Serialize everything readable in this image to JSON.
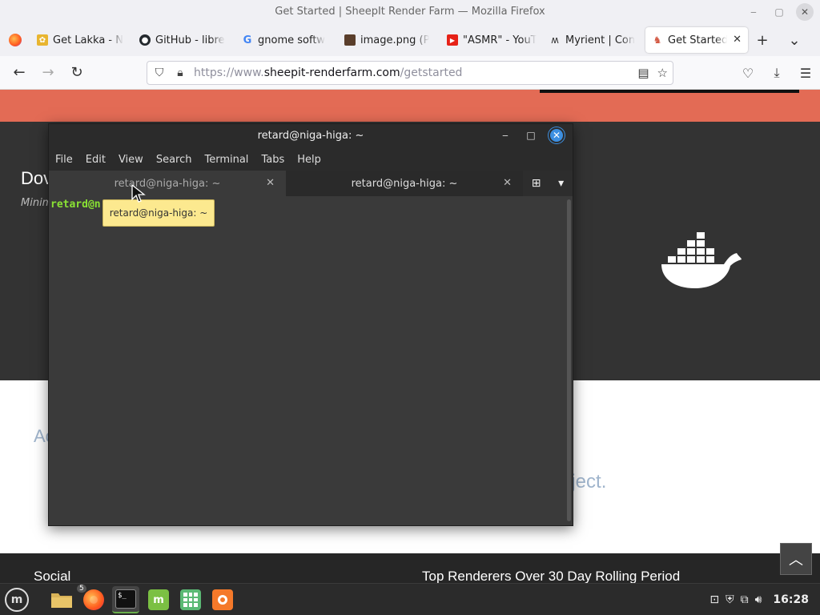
{
  "firefox": {
    "window_title": "Get Started | SheepIt Render Farm — Mozilla Firefox",
    "window_controls": {
      "minimize": "‒",
      "maximize": "▢",
      "close": "✕"
    },
    "tabs": [
      {
        "label": "Get Lakka - N",
        "icon": "lakka-favicon"
      },
      {
        "label": "GitHub - libre",
        "icon": "github-favicon"
      },
      {
        "label": "gnome softw",
        "icon": "google-favicon"
      },
      {
        "label": "image.png (P",
        "icon": "image-favicon"
      },
      {
        "label": "\"ASMR\" - YouT",
        "icon": "youtube-favicon"
      },
      {
        "label": "Myrient | Con",
        "icon": "myrient-favicon"
      },
      {
        "label": "Get Started",
        "icon": "sheepit-favicon",
        "active": true
      }
    ],
    "new_tab": "+",
    "tab_list": "⌄",
    "url": {
      "prefix": "https://www.",
      "host": "sheepit-renderfarm.com",
      "path": "/getstarted"
    },
    "back": "←",
    "forward": "→",
    "reload": "↻"
  },
  "page": {
    "download_title": "Dov",
    "download_sub": "Minim",
    "ad_text": "Ac",
    "project_text": "oject.",
    "social": "Social",
    "top_renderers": "Top Renderers Over 30 Day Rolling Period",
    "scroll_top": "︿"
  },
  "terminal": {
    "title": "retard@niga-higa: ~",
    "menu": [
      "File",
      "Edit",
      "View",
      "Search",
      "Terminal",
      "Tabs",
      "Help"
    ],
    "tabs": [
      {
        "label": "retard@niga-higa: ~"
      },
      {
        "label": "retard@niga-higa: ~"
      }
    ],
    "prompt": "retard@n",
    "tooltip": "retard@niga-higa: ~"
  },
  "taskbar": {
    "menu_logo": "m",
    "firefox_badge": "5",
    "clock": "16:28"
  },
  "colors": {
    "accent_orange": "#e36b55",
    "dark_section": "#333333",
    "prompt_green": "#8ae234",
    "tooltip_bg": "#fce98f"
  }
}
